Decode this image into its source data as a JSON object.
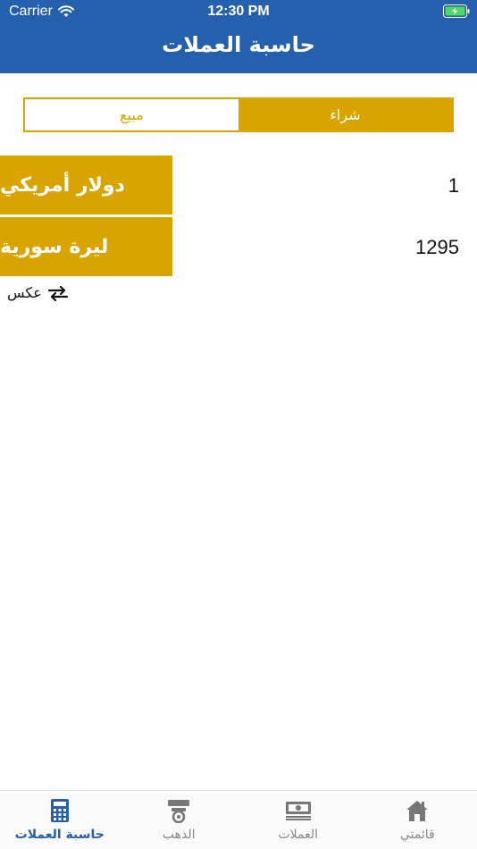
{
  "status_bar": {
    "carrier": "Carrier",
    "time": "12:30 PM"
  },
  "nav": {
    "title": "حاسبة العملات"
  },
  "segment": {
    "sell_label": "مبيع",
    "buy_label": "شراء",
    "selected": "buy"
  },
  "converter": {
    "from": {
      "currency": "دولار أمريكي",
      "amount": "1"
    },
    "to": {
      "currency": "ليرة سورية",
      "amount": "1295"
    },
    "swap_label": "عكس"
  },
  "tabbar": {
    "items": [
      {
        "label": "حاسبة العملات",
        "icon": "calculator-icon",
        "active": true
      },
      {
        "label": "الذهب",
        "icon": "gold-icon",
        "active": false
      },
      {
        "label": "العملات",
        "icon": "money-icon",
        "active": false
      },
      {
        "label": "قائمتي",
        "icon": "home-icon",
        "active": false
      }
    ]
  },
  "colors": {
    "header": "#2460ad",
    "accent_gold": "#d9a400",
    "tab_active": "#2460ad",
    "tab_inactive": "#888888"
  }
}
